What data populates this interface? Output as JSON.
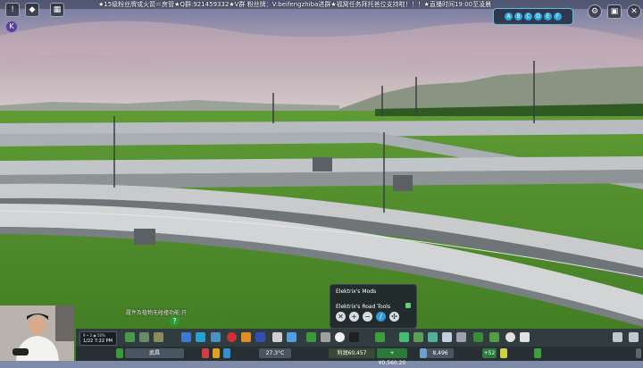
{
  "banner": "★15级粉丝牌或火箭＝房管★Q群:921459332★V群 粉丝牌：V:beifengzhiba进群★福窝任务拜托爸位支持啦！！！★直播时间19:00至凌晨",
  "top_left_icons": [
    "notifications-icon",
    "chirper-icon",
    "info-views-icon"
  ],
  "top_right_icons": [
    "gear-icon",
    "photo-mode-icon",
    "close-icon"
  ],
  "k_badge": "K",
  "speed_dots": [
    "A",
    "B",
    "C",
    "D",
    "E",
    "F"
  ],
  "mods_panel": {
    "title": "Elektrix's Mods",
    "subtitle": "Elektrix's Road Tools",
    "tools": [
      "✕",
      "+",
      "−",
      "/",
      "✣"
    ]
  },
  "hint_text": "履件及植物无碰撞功能:开",
  "hint_button": "?",
  "clock": {
    "line1": "9 • 2 ◉ 50%",
    "line2": "1/22 7:22 PM"
  },
  "bottom_bar": {
    "weather": "27.3°C",
    "city_name": "武昌",
    "money_label": "利润60,457",
    "income_badge": "+¥0,560.20",
    "population": "8,496",
    "population_change": "+52"
  },
  "colors": {
    "accent": "#2da7e0",
    "panel": "#202630",
    "grass": "#4e8a2c"
  }
}
